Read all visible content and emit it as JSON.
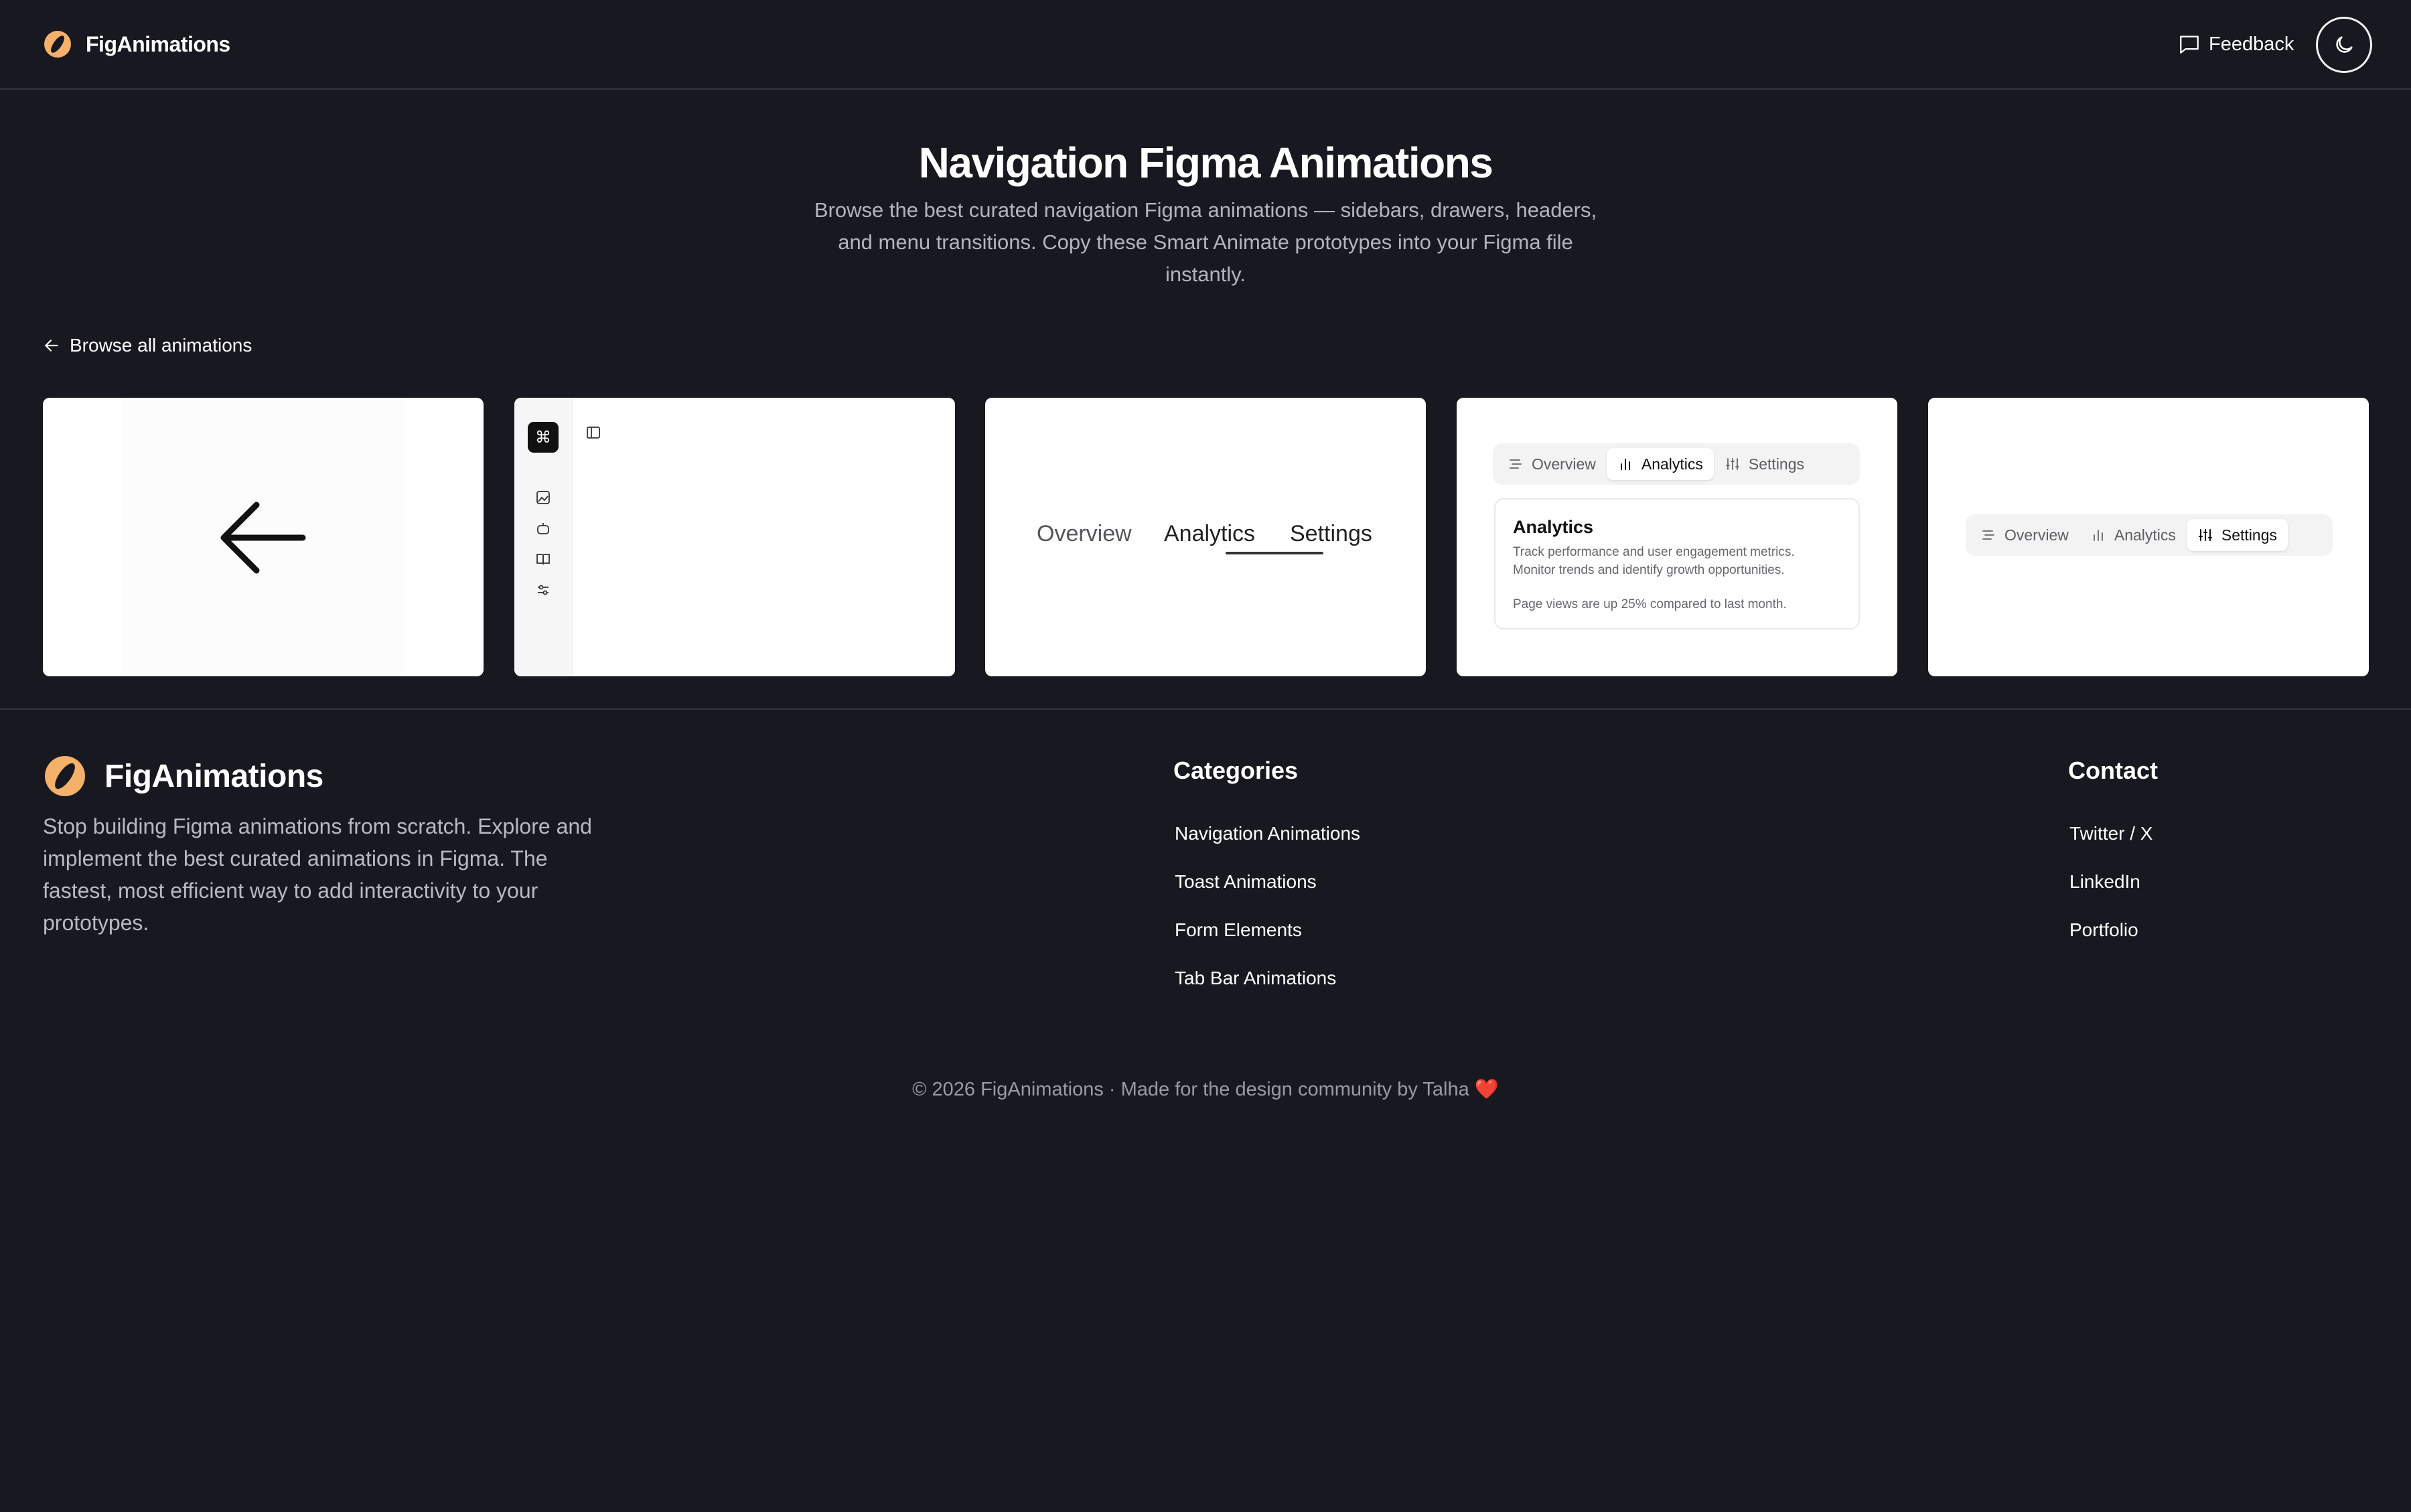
{
  "header": {
    "brand": "FigAnimations",
    "feedback_label": "Feedback"
  },
  "hero": {
    "title": "Navigation Figma Animations",
    "subtitle": "Browse the best curated navigation Figma animations — sidebars, drawers, headers, and menu transitions. Copy these Smart Animate prototypes into your Figma file instantly.",
    "back_link": "Browse all animations"
  },
  "cards": {
    "card3": {
      "tabs": [
        "Overview",
        "Analytics",
        "Settings"
      ]
    },
    "card4": {
      "tabs": [
        "Overview",
        "Analytics",
        "Settings"
      ],
      "active": "Analytics",
      "panel_title": "Analytics",
      "panel_line1": "Track performance and user engagement metrics.",
      "panel_line2": "Monitor trends and identify growth opportunities.",
      "panel_note": "Page views are up 25% compared to last month."
    },
    "card5": {
      "tabs": [
        "Overview",
        "Analytics",
        "Settings"
      ],
      "active": "Settings"
    }
  },
  "footer": {
    "brand": "FigAnimations",
    "description": "Stop building Figma animations from scratch. Explore and implement the best curated animations in Figma. The fastest, most efficient way to add interactivity to your prototypes.",
    "categories_title": "Categories",
    "categories": [
      "Navigation Animations",
      "Toast Animations",
      "Form Elements",
      "Tab Bar Animations"
    ],
    "contact_title": "Contact",
    "contact": [
      "Twitter / X",
      "LinkedIn",
      "Portfolio"
    ],
    "copyright": "© 2026 FigAnimations · Made for the design community by Talha ❤️"
  },
  "colors": {
    "background": "#181820",
    "logo_accent": "#f4b16a",
    "text_primary": "#ffffff",
    "text_muted": "#b4b4be"
  },
  "icons": [
    "logo-icon",
    "feedback-icon",
    "moon-icon",
    "arrow-left-icon",
    "command-icon",
    "sidebar-panel-icon",
    "list-icon",
    "bar-chart-icon",
    "sliders-icon"
  ]
}
